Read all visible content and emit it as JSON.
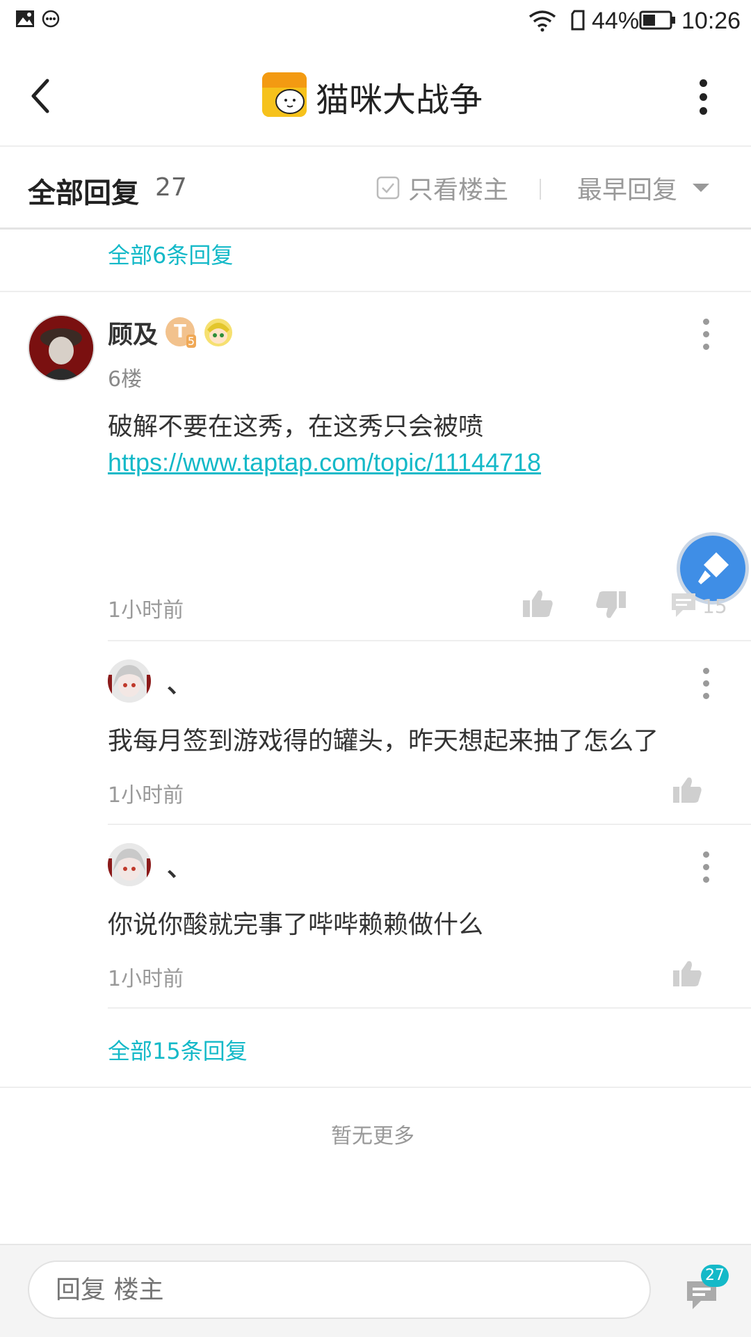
{
  "status_bar": {
    "battery": "44%",
    "time": "10:26"
  },
  "header": {
    "title": "猫咪大战争"
  },
  "filter": {
    "title": "全部回复",
    "count": "27",
    "only_author_label": "只看楼主",
    "sort_label": "最早回复"
  },
  "previous_thread": {
    "all_replies_link": "全部6条回复"
  },
  "post": {
    "username": "顾及",
    "badge_text": "T",
    "badge_level": "5",
    "floor": "6楼",
    "content": "破解不要在这秀，在这秀只会被喷",
    "link": "https://www.taptap.com/topic/11144718",
    "time": "1小时前",
    "comment_count": "15",
    "replies": [
      {
        "username": "、",
        "content": "我每月签到游戏得的罐头，昨天想起来抽了怎么了",
        "time": "1小时前"
      },
      {
        "username": "、",
        "content": "你说你酸就完事了哔哔赖赖做什么",
        "time": "1小时前"
      }
    ],
    "all_replies_link": "全部15条回复"
  },
  "footer": {
    "no_more": "暂无更多"
  },
  "reply_bar": {
    "placeholder": "回复 楼主",
    "badge_count": "27"
  },
  "colors": {
    "accent": "#14b9c8",
    "float_button": "#3f8ee6"
  }
}
